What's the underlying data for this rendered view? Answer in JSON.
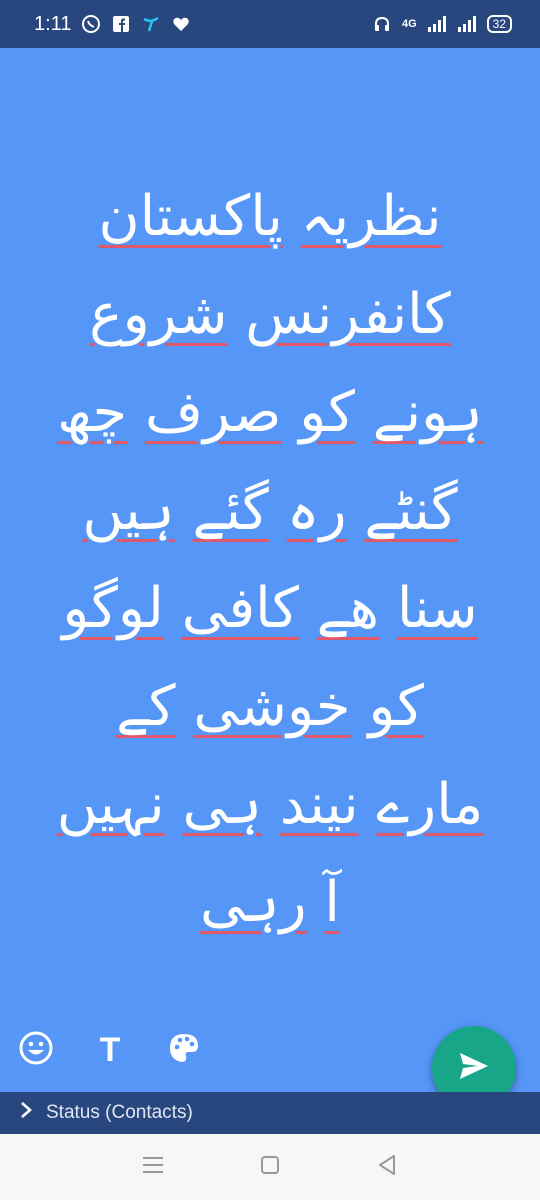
{
  "status_bar": {
    "time": "1:11",
    "network_label": "4G",
    "battery": "32"
  },
  "status_text": {
    "lines": [
      [
        "نظریہ",
        "پاکستان"
      ],
      [
        "کانفرنس",
        "شروع"
      ],
      [
        "ہونے",
        "کو",
        "صرف",
        "چھ"
      ],
      [
        "گنٹے",
        "رہ",
        "گئے",
        "ہیں"
      ],
      [
        "سنا",
        "ھے",
        "کافی",
        "لوگو"
      ],
      [
        "کو",
        "خوشی",
        "کے"
      ],
      [
        "مارے",
        "نیند",
        "ہی",
        "نہیں"
      ],
      [
        "آ",
        "رہی"
      ]
    ]
  },
  "toolbar": {
    "emoji_icon": "emoji-icon",
    "text_label": "T",
    "palette_icon": "palette-icon"
  },
  "send_button": {
    "icon": "send-icon"
  },
  "audience": {
    "chevron": "›",
    "label": "Status (Contacts)"
  },
  "navigation": {
    "menu_icon": "menu-icon",
    "home_icon": "home-icon",
    "back_icon": "back-icon"
  },
  "colors": {
    "background": "#5596f7",
    "bars": "#28477f",
    "send": "#17a688",
    "underline": "#e2586b"
  }
}
